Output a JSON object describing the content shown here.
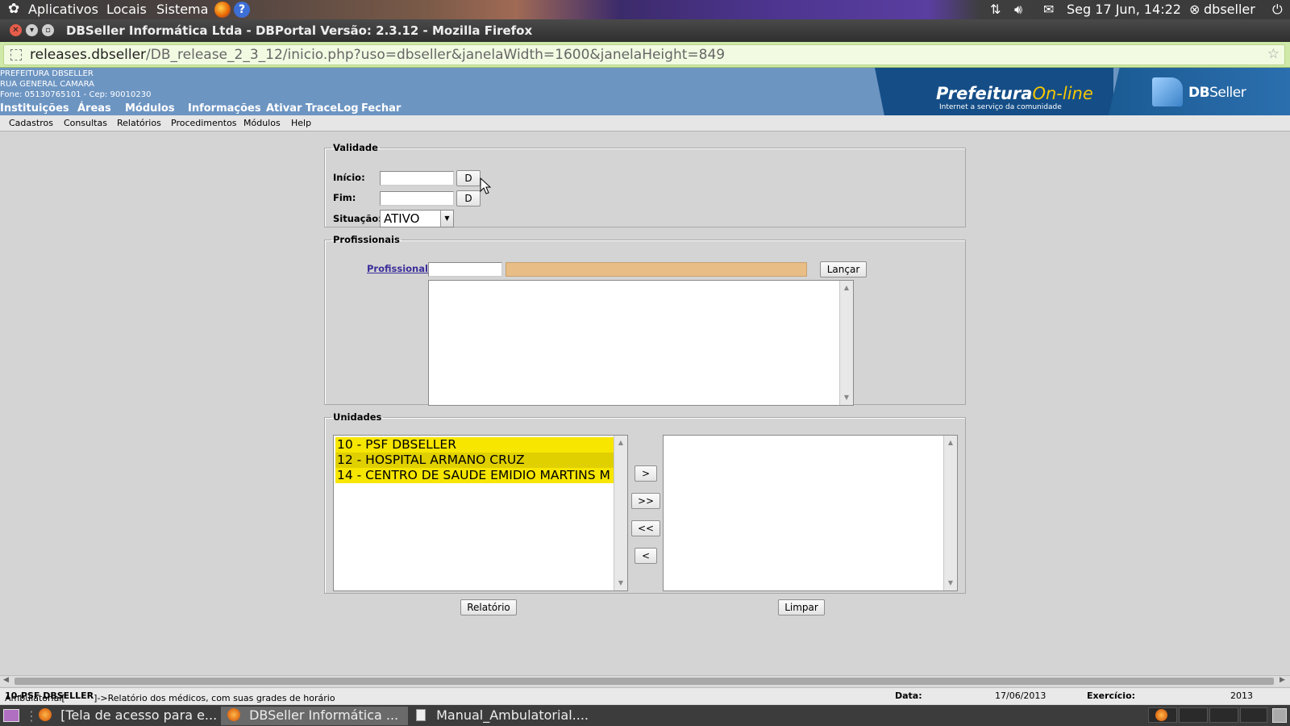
{
  "top_panel": {
    "apps": "Aplicativos",
    "places": "Locais",
    "system": "Sistema",
    "datetime": "Seg 17 Jun, 14:22",
    "user": "dbseller"
  },
  "window": {
    "title": "DBSeller Informática Ltda - DBPortal Versão: 2.3.12 - Mozilla Firefox"
  },
  "urlbar": {
    "host": "releases.dbseller",
    "path": "/DB_release_2_3_12/inicio.php?uso=dbseller&janelaWidth=1600&janelaHeight=849"
  },
  "header": {
    "org_lines": [
      "PREFEITURA DBSELLER",
      "RUA GENERAL CAMARA",
      "Fone: 05130765101  -  Cep: 90010230"
    ],
    "menu": [
      "Instituições",
      "Áreas",
      "Módulos",
      "Informações",
      "Ativar TraceLog",
      "Fechar"
    ],
    "logo_prefeitura": "Prefeitura",
    "logo_online": "On-line",
    "logo_tagline": "Internet a serviço da comunidade",
    "logo_db_bold": "DB",
    "logo_db_rest": "Seller"
  },
  "submenu": [
    "Cadastros",
    "Consultas",
    "Relatórios",
    "Procedimentos",
    "Módulos",
    "Help"
  ],
  "validade": {
    "legend": "Validade",
    "inicio_label": "Início:",
    "inicio_value": "",
    "fim_label": "Fim:",
    "fim_value": "",
    "date_button": "D",
    "situacao_label": "Situação:",
    "situacao_value": "ATIVO"
  },
  "profissionais": {
    "legend": "Profissionais",
    "link_label": "Profissional:",
    "code_value": "",
    "name_value": "",
    "lancar_button": "Lançar",
    "selected_list": []
  },
  "unidades": {
    "legend": "Unidades",
    "available": [
      "10 - PSF DBSELLER",
      "12 - HOSPITAL ARMANO CRUZ",
      "14 - CENTRO DE SAUDE EMIDIO MARTINS M"
    ],
    "selected": [],
    "btn_add": ">",
    "btn_add_all": ">>",
    "btn_remove_all": "<<",
    "btn_remove": "<"
  },
  "actions": {
    "relatorio": "Relatório",
    "limpar": "Limpar"
  },
  "statusbar": {
    "prefix": "Ambulatorial[",
    "unit": "10-PSF DBSELLER",
    "suffix": "]->Relatório dos médicos, com suas grades de horário",
    "data_label": "Data:",
    "data_value": "17/06/2013",
    "exercicio_label": "Exercício:",
    "exercicio_value": "2013"
  },
  "taskbar": {
    "tasks": [
      "[Tela de acesso para e...",
      "DBSeller Informática ...",
      "Manual_Ambulatorial...."
    ]
  },
  "colors": {
    "header_bg": "#6d95c2",
    "selected_item": "#f7e600",
    "orange_field": "#e8bd86"
  }
}
